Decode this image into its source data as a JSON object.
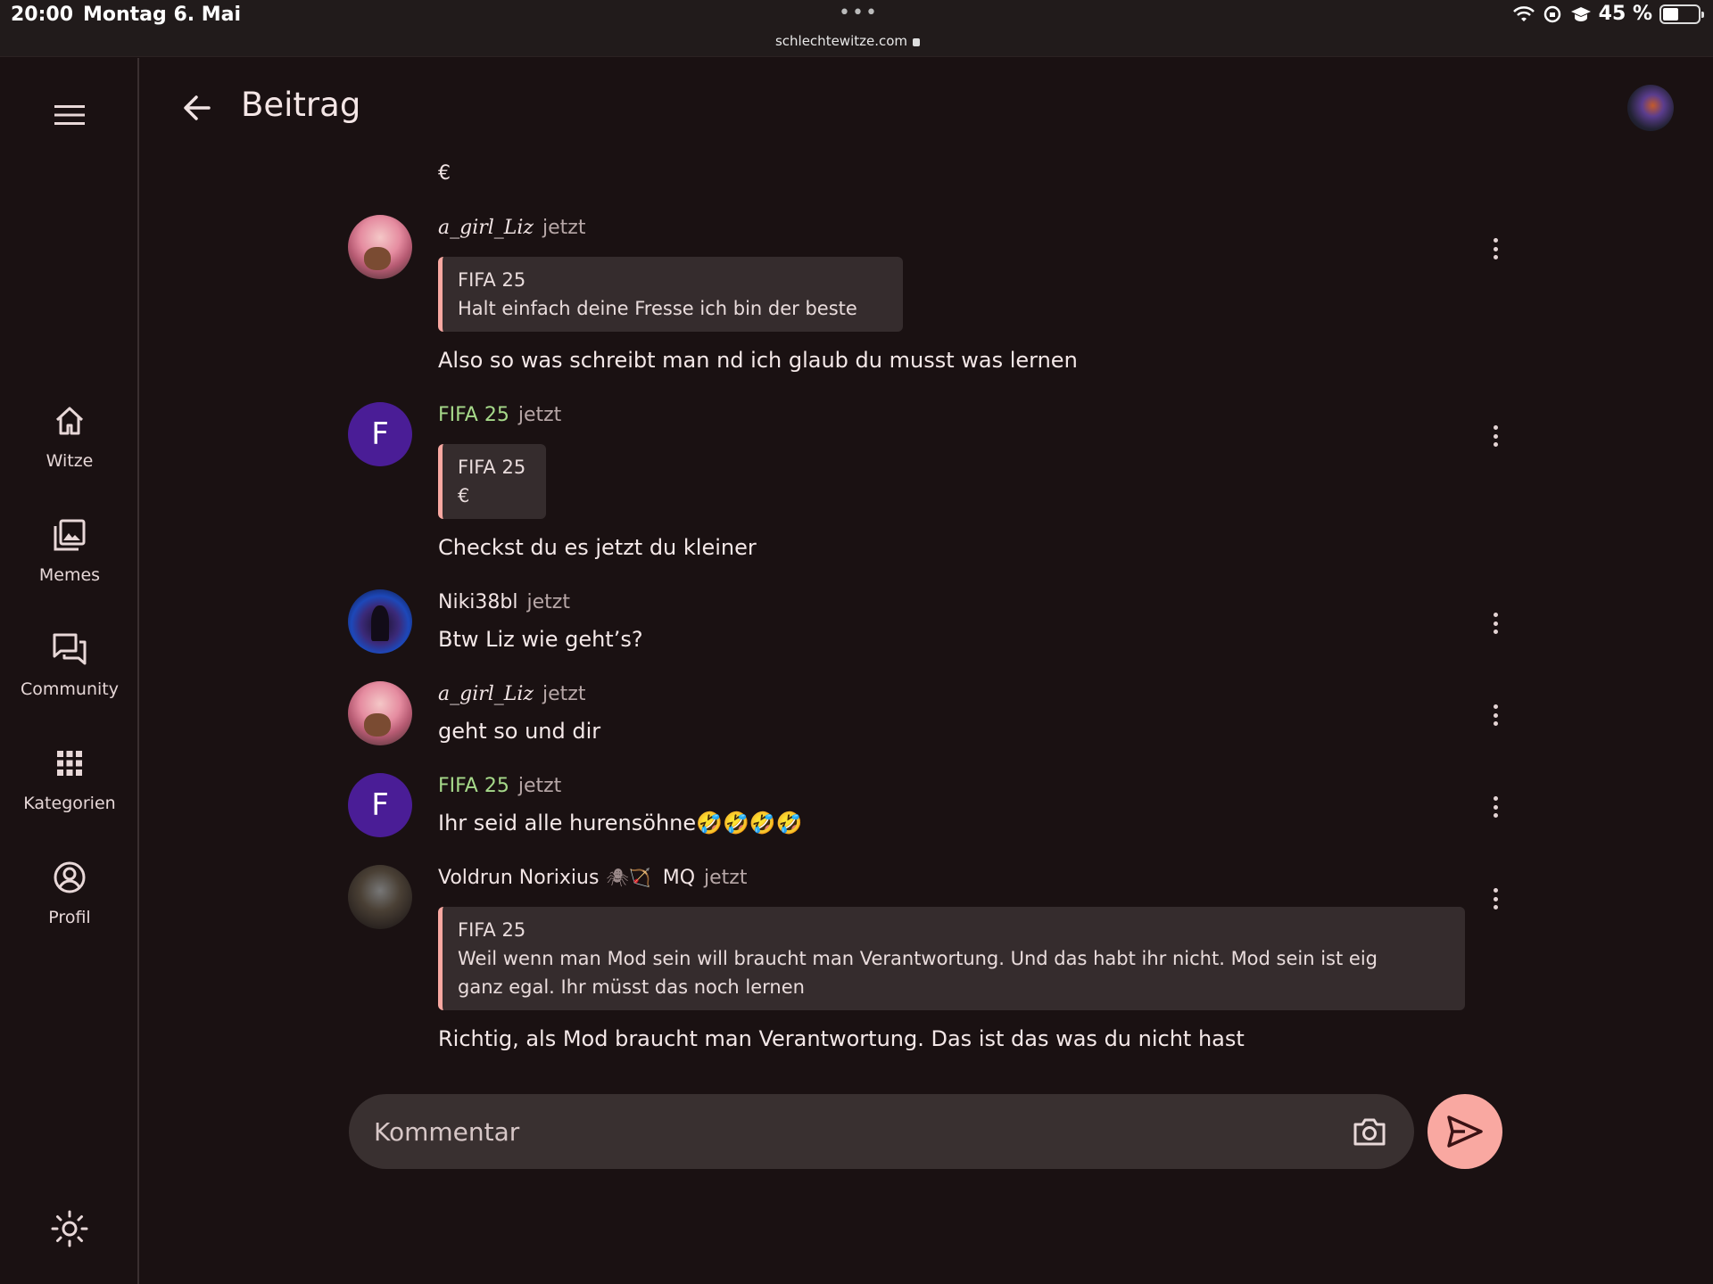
{
  "status_bar": {
    "time": "20:00",
    "date": "Montag 6. Mai",
    "url": "schlechtewitze.com",
    "battery": "45 %",
    "battery_level": 0.45
  },
  "nav": {
    "items": [
      {
        "label": "Witze",
        "icon": "home-icon"
      },
      {
        "label": "Memes",
        "icon": "images-icon"
      },
      {
        "label": "Community",
        "icon": "forum-icon"
      },
      {
        "label": "Kategorien",
        "icon": "grid-icon"
      },
      {
        "label": "Profil",
        "icon": "account-circle-icon"
      }
    ]
  },
  "header": {
    "title": "Beitrag"
  },
  "feed": {
    "top_fragment": "€",
    "messages": [
      {
        "author": "a_girl_Liz",
        "time": "jetzt",
        "quote_author": "FIFA 25",
        "quote_text": "Halt einfach deine Fresse ich bin der beste",
        "text": "Also so was schreibt man nd ich glaub du musst was lernen"
      },
      {
        "author": "FIFA 25",
        "avatar_letter": "F",
        "time": "jetzt",
        "quote_author": "FIFA 25",
        "quote_text": "€",
        "text": "Checkst du es jetzt du kleiner"
      },
      {
        "author": "Niki38bl",
        "time": "jetzt",
        "text": "Btw Liz wie geht’s?"
      },
      {
        "author": "a_girl_Liz",
        "time": "jetzt",
        "text": "geht so und dir"
      },
      {
        "author": "FIFA 25",
        "avatar_letter": "F",
        "time": "jetzt",
        "text": "Ihr seid alle hurensöhne🤣🤣🤣🤣"
      },
      {
        "author": "Voldrun Norixius",
        "badge_icons": "🕷🏹",
        "badge": "MQ",
        "time": "jetzt",
        "quote_author": "FIFA 25",
        "quote_text_line1": "Weil wenn man Mod sein will braucht man Verantwortung. Und das habt ihr nicht. Mod sein ist eig",
        "quote_text_line2": "ganz egal. Ihr müsst das noch lernen",
        "text": "Richtig, als Mod braucht man Verantwortung. Das ist das was du nicht hast"
      }
    ]
  },
  "composer": {
    "placeholder": "Kommentar"
  },
  "colors": {
    "background": "#1a1112",
    "accent": "#f9a8a1",
    "author_green": "#a6d98a",
    "avatar_purple": "#4a1d96",
    "quote_bg": "#352c2d"
  }
}
